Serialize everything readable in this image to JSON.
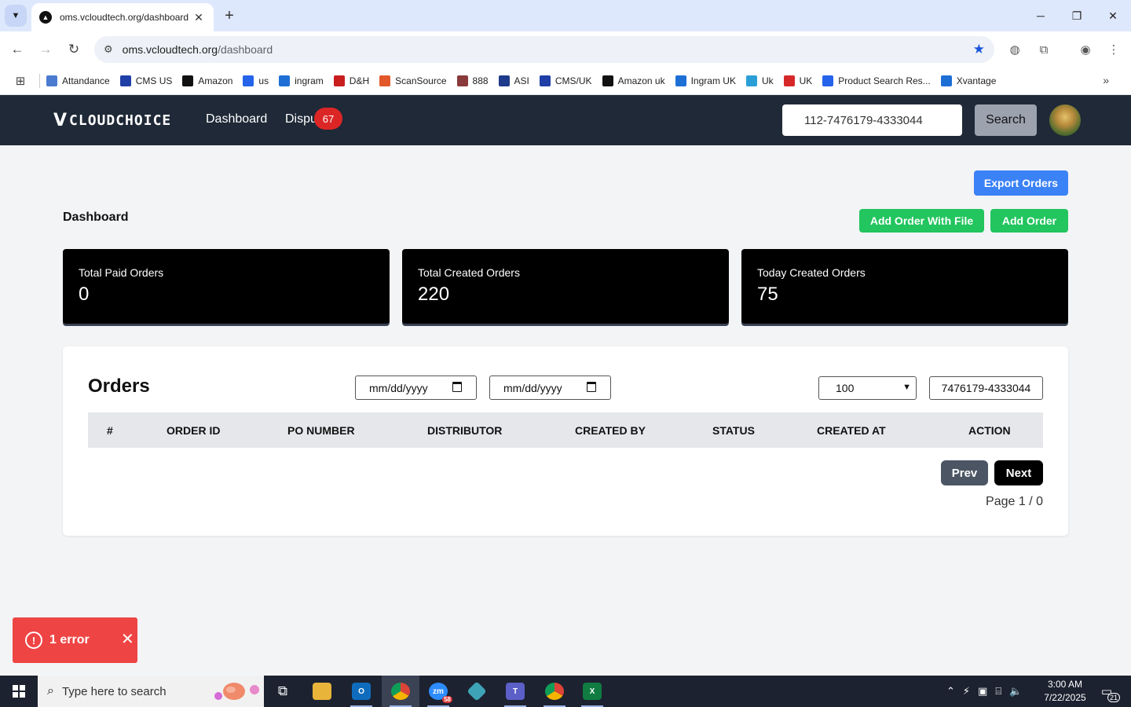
{
  "browser": {
    "tab_title": "oms.vcloudtech.org/dashboard",
    "url_host": "oms.vcloudtech.org",
    "url_path": "/dashboard",
    "bookmarks": [
      {
        "label": "Attandance",
        "icon": "attendance-icon",
        "color": "#4a7bd1"
      },
      {
        "label": "CMS US",
        "icon": "cms-icon",
        "color": "#1f3fa6"
      },
      {
        "label": "Amazon",
        "icon": "amazon-icon",
        "color": "#111111"
      },
      {
        "label": "us",
        "icon": "ec-icon",
        "color": "#2563eb"
      },
      {
        "label": "ingram",
        "icon": "ingram-icon",
        "color": "#1d6fd6"
      },
      {
        "label": "D&H",
        "icon": "dh-icon",
        "color": "#c81e1e"
      },
      {
        "label": "ScanSource",
        "icon": "scansource-icon",
        "color": "#e2582a"
      },
      {
        "label": "888",
        "icon": "888-icon",
        "color": "#8a3a3a"
      },
      {
        "label": "ASI",
        "icon": "asi-icon",
        "color": "#1e3a8a"
      },
      {
        "label": "CMS/UK",
        "icon": "cms-icon",
        "color": "#1f3fa6"
      },
      {
        "label": "Amazon uk",
        "icon": "amazon-icon",
        "color": "#111111"
      },
      {
        "label": "Ingram UK",
        "icon": "ingram-icon",
        "color": "#1d6fd6"
      },
      {
        "label": "Uk",
        "icon": "uk-icon",
        "color": "#2a9fd6"
      },
      {
        "label": "UK",
        "icon": "ex-icon",
        "color": "#d62828"
      },
      {
        "label": "Product Search Res...",
        "icon": "ec-icon",
        "color": "#2563eb"
      },
      {
        "label": "Xvantage",
        "icon": "ingram-icon",
        "color": "#1d6fd6"
      }
    ]
  },
  "header": {
    "logo_text": "CLOUDCHOICE",
    "nav": [
      {
        "label": "Dashboard"
      },
      {
        "label": "Dispu"
      }
    ],
    "badge_count": "67",
    "search_value": "112-7476179-4333044",
    "search_label": "Search"
  },
  "dashboard": {
    "export_label": "Export Orders",
    "add_file_label": "Add Order With File",
    "add_order_label": "Add Order",
    "title": "Dashboard",
    "stats": [
      {
        "label": "Total Paid Orders",
        "value": "0"
      },
      {
        "label": "Total Created Orders",
        "value": "220"
      },
      {
        "label": "Today Created Orders",
        "value": "75"
      }
    ]
  },
  "orders": {
    "title": "Orders",
    "date_from_placeholder": "mm/dd/yyyy",
    "date_to_placeholder": "mm/dd/yyyy",
    "page_size": "100",
    "search_value": "7476179-4333044",
    "columns": [
      "#",
      "ORDER ID",
      "PO NUMBER",
      "DISTRIBUTOR",
      "CREATED BY",
      "STATUS",
      "CREATED AT",
      "ACTION"
    ],
    "prev_label": "Prev",
    "next_label": "Next",
    "page_info": "Page 1 / 0"
  },
  "toast": {
    "text": "1 error"
  },
  "taskbar": {
    "search_placeholder": "Type here to search",
    "zoom_badge": "58",
    "time": "3:00 AM",
    "date": "7/22/2025",
    "notification_count": "21"
  },
  "colors": {
    "header_bg": "#1f2937",
    "primary_blue": "#3b82f6",
    "success_green": "#22c55e",
    "error_red": "#ef4444",
    "badge_red": "#dc2626"
  }
}
